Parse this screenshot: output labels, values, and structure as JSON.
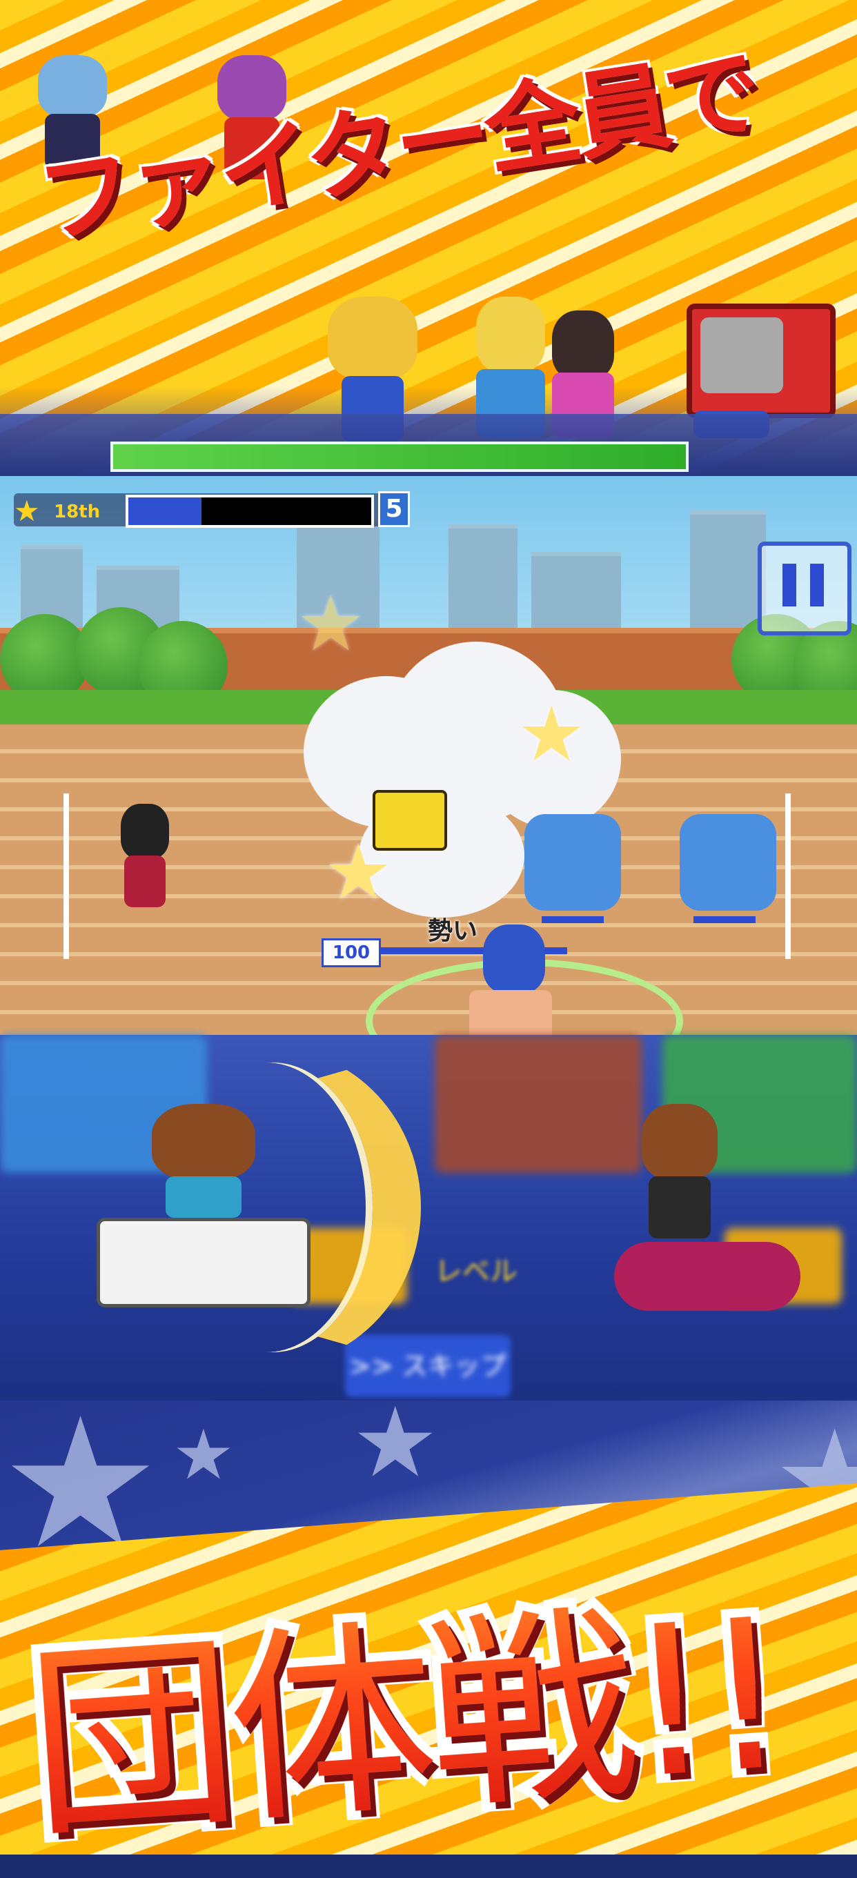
{
  "catch_copy": {
    "top": "ファイター全員で",
    "bottom": "団体戦!!"
  },
  "hud": {
    "rank_num": "18th",
    "rank_gauge": {
      "value": 0.3
    },
    "level": "5",
    "pause_icon": "pause-icon"
  },
  "battle": {
    "momentum_label": "勢い",
    "momentum_value": "100",
    "momentum_gauge": {
      "value": 1.0
    }
  },
  "background_ui": {
    "level_label": "レベル",
    "skip_button": ">> スキップ"
  },
  "colors": {
    "catch_red": "#e8231c",
    "banner_yellow": "#ffd21f",
    "hud_blue": "#2c4bd0",
    "track": "#d7a06b"
  }
}
